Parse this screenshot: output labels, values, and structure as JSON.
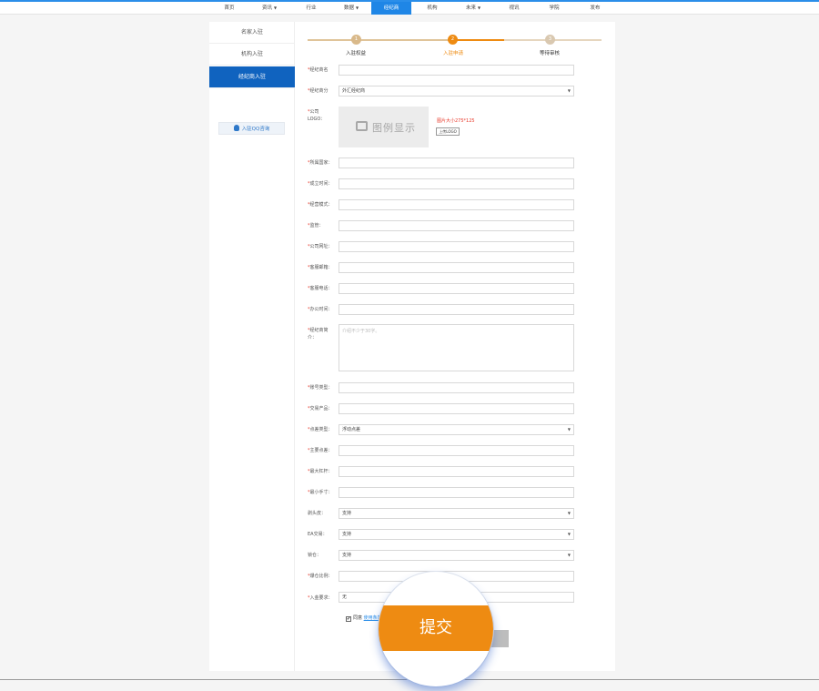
{
  "nav": {
    "items": [
      {
        "label": "首页"
      },
      {
        "label": "资讯",
        "caret": "▼"
      },
      {
        "label": "行业"
      },
      {
        "label": "数据",
        "caret": "▼"
      },
      {
        "label": "经纪商"
      },
      {
        "label": "机构"
      },
      {
        "label": "未来",
        "caret": "▼"
      },
      {
        "label": "视讯"
      },
      {
        "label": "学院"
      },
      {
        "label": "发布"
      }
    ],
    "active": "经纪商"
  },
  "sidebar": {
    "items": [
      {
        "label": "名家入驻"
      },
      {
        "label": "机构入驻"
      },
      {
        "label": "经纪商入驻"
      }
    ],
    "qq_button": "入驻QQ咨询"
  },
  "steps": [
    {
      "number": "1",
      "label": "入驻权益"
    },
    {
      "number": "2",
      "label": "入驻申请"
    },
    {
      "number": "3",
      "label": "等待审核"
    }
  ],
  "form": {
    "required_mark": "*",
    "name_label": "经纪商名",
    "type_label": "经纪商分",
    "type_value": "外汇经纪商",
    "logo_label_1": "公司",
    "logo_label_2": "LOGO：",
    "logo_placeholder": "图例显示",
    "logo_hint": "图片大小275*125",
    "upload_label": "上传LOGO",
    "country_label": "所属国家：",
    "founded_label": "成立时间：",
    "model_label": "经营模式：",
    "regulation_label": "监管：",
    "website_label": "公司网址：",
    "email_label": "客服邮箱：",
    "phone_label": "客服电话：",
    "hours_label": "办公时间：",
    "intro_label_1": "经纪商简",
    "intro_label_2": "介：",
    "intro_placeholder": "介绍不少于30字。",
    "account_type_label": "账号类型：",
    "products_label": "交易产品：",
    "spread_type_label": "点差类型：",
    "spread_type_value": "浮动点差",
    "main_spread_label": "主要点差：",
    "max_leverage_label": "最大杠杆：",
    "min_lot_label": "最小手寸：",
    "scalping_label": "剥头皮：",
    "scalping_value": "支持",
    "ea_label": "EA交易：",
    "ea_value": "支持",
    "hedging_label": "锁仓：",
    "hedging_value": "支持",
    "margin_label": "爆仓比例：",
    "deposit_label": "入金要求：",
    "deposit_value": "无",
    "agree_check": "✔",
    "agree_text": "同意",
    "agree_link": "使用条款"
  },
  "submit_label": "提交",
  "colors": {
    "nav_active": "#1f86e6",
    "sidebar_active": "#1063bf",
    "step_done": "#d9b98a",
    "step_active": "#ee8b12",
    "submit": "#ee8b12"
  }
}
